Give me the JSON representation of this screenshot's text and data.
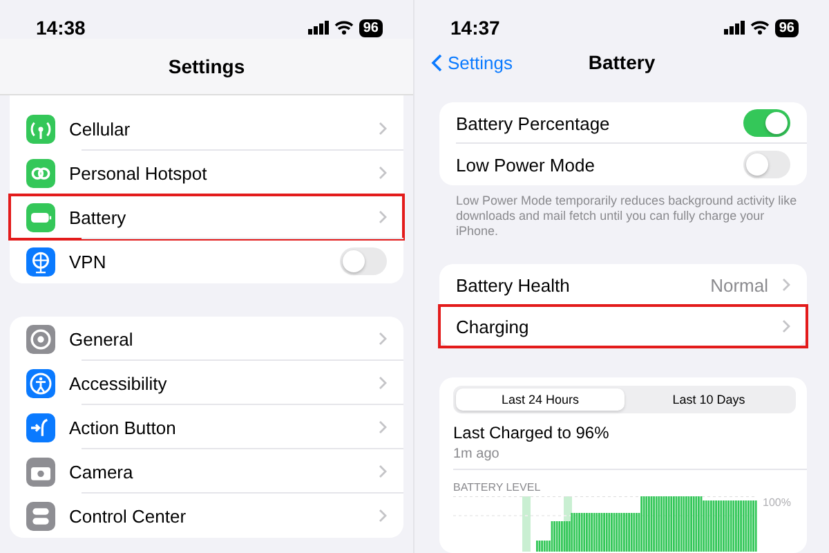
{
  "left": {
    "status": {
      "time": "14:38",
      "battery": "96"
    },
    "title": "Settings",
    "groups": [
      {
        "rows": [
          {
            "label": "Cellular",
            "kind": "link",
            "color": "#34c759",
            "highlighted": false
          },
          {
            "label": "Personal Hotspot",
            "kind": "link",
            "color": "#34c759",
            "highlighted": false
          },
          {
            "label": "Battery",
            "kind": "link",
            "color": "#34c759",
            "highlighted": true
          },
          {
            "label": "VPN",
            "kind": "toggle",
            "on": false,
            "color": "#0a7aff",
            "highlighted": false
          }
        ]
      },
      {
        "rows": [
          {
            "label": "General",
            "kind": "link",
            "color": "#8e8e93",
            "highlighted": false
          },
          {
            "label": "Accessibility",
            "kind": "link",
            "color": "#0a7aff",
            "highlighted": false
          },
          {
            "label": "Action Button",
            "kind": "link",
            "color": "#0a7aff",
            "highlighted": false
          },
          {
            "label": "Camera",
            "kind": "link",
            "color": "#8e8e93",
            "highlighted": false
          },
          {
            "label": "Control Center",
            "kind": "link",
            "color": "#8e8e93",
            "highlighted": false
          }
        ]
      }
    ]
  },
  "right": {
    "status": {
      "time": "14:37",
      "battery": "96"
    },
    "back": "Settings",
    "title": "Battery",
    "groups": [
      {
        "rows": [
          {
            "label": "Battery Percentage",
            "kind": "toggle",
            "on": true,
            "highlighted": false
          },
          {
            "label": "Low Power Mode",
            "kind": "toggle",
            "on": false,
            "highlighted": false
          }
        ],
        "footer": "Low Power Mode temporarily reduces background activity like downloads and mail fetch until you can fully charge your iPhone."
      },
      {
        "rows": [
          {
            "label": "Battery Health",
            "value": "Normal",
            "kind": "link",
            "highlighted": false
          },
          {
            "label": "Charging",
            "kind": "link",
            "highlighted": true
          }
        ]
      }
    ],
    "usage": {
      "tabs": [
        {
          "label": "Last 24 Hours",
          "selected": true
        },
        {
          "label": "Last 10 Days",
          "selected": false
        }
      ],
      "headline": "Last Charged to 96%",
      "subline": "1m ago",
      "section": "BATTERY LEVEL",
      "axis_label": "100%"
    }
  }
}
